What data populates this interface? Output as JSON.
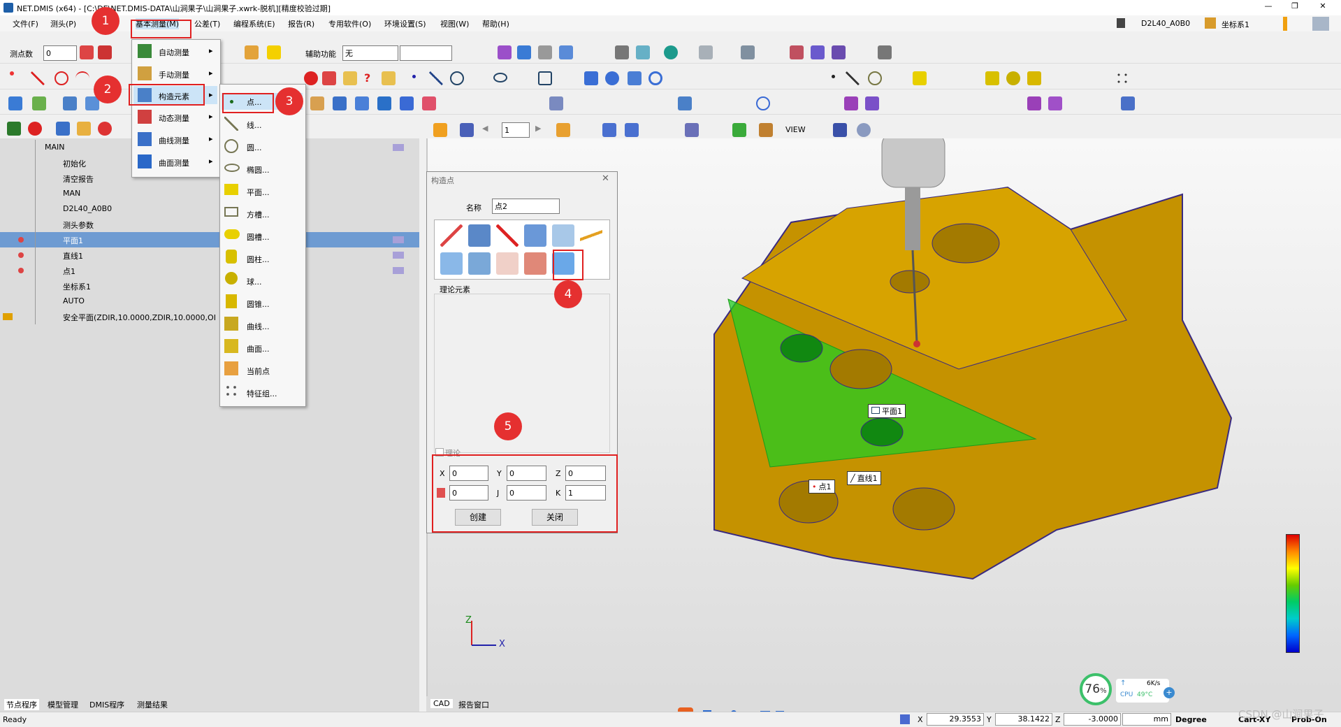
{
  "title_bar": {
    "text": "NET.DMIS (x64) - [C:\\DE\\NET.DMIS-DATA\\山涧果子\\山涧果子.xwrk-脱机][精度校验过期]"
  },
  "menu": [
    {
      "label": "文件(F)"
    },
    {
      "label": "测头(P)"
    },
    {
      "label": "基本测量(M)"
    },
    {
      "label": "公差(T)"
    },
    {
      "label": "编程系统(E)"
    },
    {
      "label": "报告(R)"
    },
    {
      "label": "专用软件(O)"
    },
    {
      "label": "环境设置(S)"
    },
    {
      "label": "视图(W)"
    },
    {
      "label": "帮助(H)"
    }
  ],
  "top_right": {
    "probe": "D2L40_A0B0",
    "coord_sys": "坐标系1"
  },
  "toolbar": {
    "point_count_label": "测点数",
    "point_count_value": "0",
    "aux_label": "辅助功能",
    "aux_value": "无"
  },
  "dropdown1": {
    "items": [
      "自动测量",
      "手动测量",
      "构造元素",
      "动态测量",
      "曲线测量",
      "曲面测量"
    ]
  },
  "dropdown2": {
    "items": [
      "点...",
      "线...",
      "圆...",
      "椭圆...",
      "平面...",
      "方槽...",
      "圆槽...",
      "圆柱...",
      "球...",
      "圆锥...",
      "曲线...",
      "曲面...",
      "当前点",
      "特征组..."
    ]
  },
  "tree": {
    "root": "MAIN",
    "items": [
      "初始化",
      "清空报告",
      "MAN",
      "D2L40_A0B0",
      "测头参数",
      "平面1",
      "直线1",
      "点1",
      "坐标系1",
      "AUTO",
      "安全平面(ZDIR,10.0000,ZDIR,10.0000,OI"
    ]
  },
  "bottom_tabs": [
    "节点程序",
    "模型管理",
    "DMIS程序",
    "测量结果"
  ],
  "view_toolbar": {
    "view_label": "VIEW",
    "page": "1"
  },
  "dialog": {
    "title": "构造点",
    "name_label": "名称",
    "name_value": "点2",
    "section_label": "理论元素",
    "theory_label": "理论",
    "x_label": "X",
    "y_label": "Y",
    "z_label": "Z",
    "i_label": "I",
    "j_label": "J",
    "k_label": "K",
    "x": "0",
    "y": "0",
    "z": "0",
    "i": "0",
    "j": "0",
    "k": "1",
    "create": "创建",
    "close": "关闭"
  },
  "badges": [
    "1",
    "2",
    "3",
    "4",
    "5"
  ],
  "viewport_labels": {
    "plane": "平面1",
    "line": "直线1",
    "point": "点1",
    "axis_x": "X",
    "axis_z": "Z"
  },
  "view_tabs": [
    "CAD",
    "报告窗口"
  ],
  "perf": {
    "percent": "76",
    "percent_unit": "%",
    "speed": "6K/s",
    "cpu": "CPU",
    "temp": "49°C"
  },
  "status": {
    "ready": "Ready",
    "x_label": "X",
    "x": "29.3553",
    "y_label": "Y",
    "y": "38.1422",
    "z_label": "Z",
    "z": "-3.0000",
    "unit": "mm",
    "angle": "Degree",
    "cart": "Cart-XY",
    "probe": "Prob-On"
  },
  "watermark": "CSDN @山涧果子",
  "colors": {
    "accent_red": "#e53030",
    "selection": "#6e9bd2",
    "part": "#c59200",
    "plane_green": "#22cc22"
  }
}
